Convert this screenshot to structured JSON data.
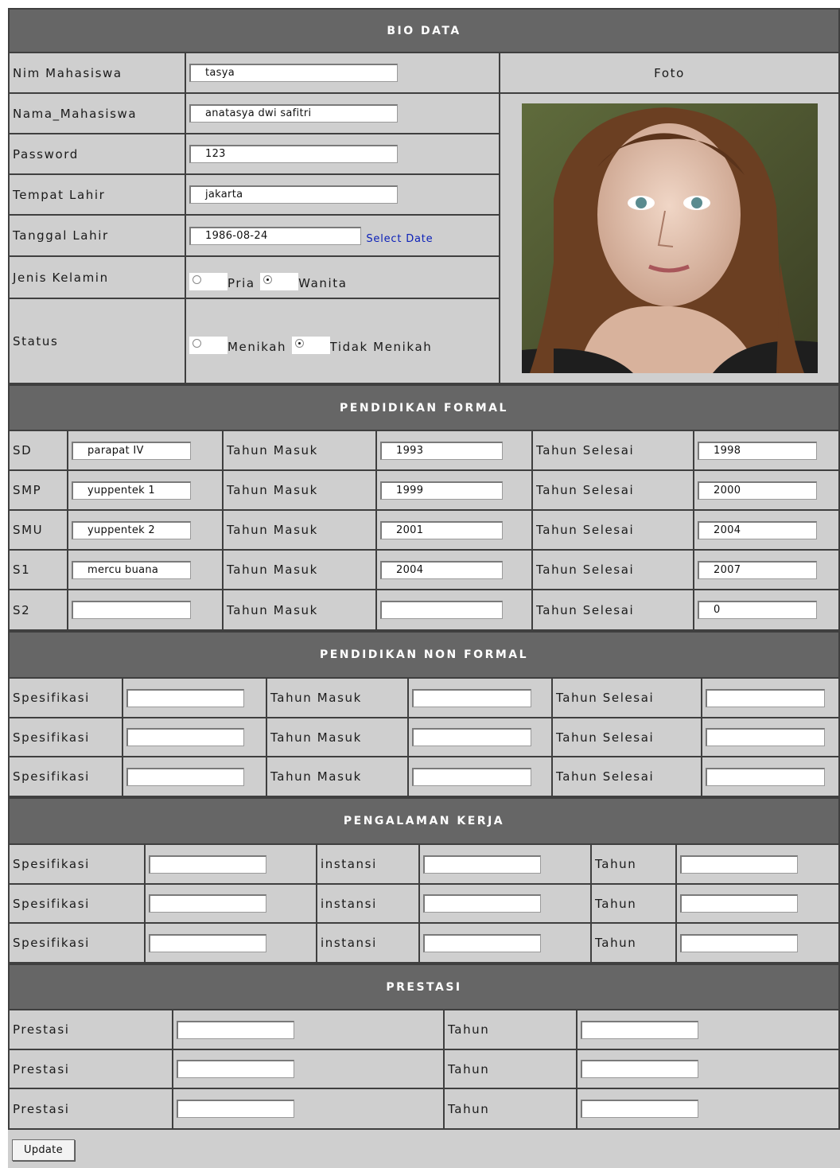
{
  "biodata": {
    "header": "BIO DATA",
    "foto_label": "Foto",
    "fields": {
      "nim": {
        "label": "Nim Mahasiswa",
        "value": "tasya"
      },
      "nama": {
        "label": "Nama_Mahasiswa",
        "value": "anatasya dwi safitri"
      },
      "password": {
        "label": "Password",
        "value": "123"
      },
      "tempat_lahir": {
        "label": "Tempat Lahir",
        "value": "jakarta"
      },
      "tanggal_lahir": {
        "label": "Tanggal Lahir",
        "value": "1986-08-24",
        "link": "Select Date"
      },
      "jenis_kelamin": {
        "label": "Jenis Kelamin",
        "options": [
          "Pria",
          "Wanita"
        ],
        "selected": "Wanita"
      },
      "status": {
        "label": "Status",
        "options": [
          "Menikah",
          "Tidak Menikah"
        ],
        "selected": "Tidak Menikah"
      }
    }
  },
  "formal": {
    "header": "PENDIDIKAN FORMAL",
    "masuk_label": "Tahun Masuk",
    "selesai_label": "Tahun Selesai",
    "rows": [
      {
        "level": "SD",
        "school": "parapat IV",
        "masuk": "1993",
        "selesai": "1998"
      },
      {
        "level": "SMP",
        "school": "yuppentek 1",
        "masuk": "1999",
        "selesai": "2000"
      },
      {
        "level": "SMU",
        "school": "yuppentek 2",
        "masuk": "2001",
        "selesai": "2004"
      },
      {
        "level": "S1",
        "school": "mercu buana",
        "masuk": "2004",
        "selesai": "2007"
      },
      {
        "level": "S2",
        "school": "",
        "masuk": "",
        "selesai": "0"
      }
    ]
  },
  "nonformal": {
    "header": "PENDIDIKAN NON FORMAL",
    "spec_label": "Spesifikasi",
    "masuk_label": "Tahun Masuk",
    "selesai_label": "Tahun Selesai"
  },
  "kerja": {
    "header": "PENGALAMAN KERJA",
    "spec_label": "Spesifikasi",
    "instansi_label": "instansi",
    "tahun_label": "Tahun"
  },
  "prestasi": {
    "header": "PRESTASI",
    "label": "Prestasi",
    "tahun_label": "Tahun"
  },
  "update_button": "Update"
}
